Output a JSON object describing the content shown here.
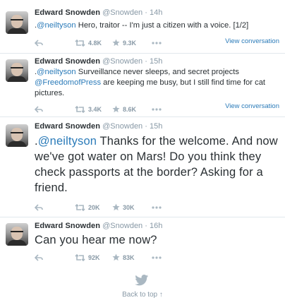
{
  "tweets": [
    {
      "name": "Edward Snowden",
      "handle": "@Snowden",
      "dot": "·",
      "time": "14h",
      "prefix": ".",
      "mention": "@neiltyson",
      "text": " Hero, traitor -- I'm just a citizen with a voice. [1/2]",
      "retweets": "4.8K",
      "favorites": "9.3K",
      "view_conversation": "View conversation"
    },
    {
      "name": "Edward Snowden",
      "handle": "@Snowden",
      "dot": "·",
      "time": "15h",
      "prefix": ".",
      "mention": "@neiltyson",
      "text": " Surveillance never sleeps, and secret projects ",
      "mention2": "@FreedomofPress",
      "text2": " are keeping me busy, but I still find time for cat pictures.",
      "retweets": "3.4K",
      "favorites": "8.6K",
      "view_conversation": "View conversation"
    },
    {
      "name": "Edward Snowden",
      "handle": "@Snowden",
      "dot": "·",
      "time": "15h",
      "prefix": ".",
      "mention": "@neiltyson",
      "text": " Thanks for the welcome. And now we've got water on Mars! Do you think they check passports at the border? Asking for a friend.",
      "retweets": "20K",
      "favorites": "30K"
    },
    {
      "name": "Edward Snowden",
      "handle": "@Snowden",
      "dot": "·",
      "time": "16h",
      "text": "Can you hear me now?",
      "retweets": "92K",
      "favorites": "83K"
    }
  ],
  "footer": {
    "back_to_top": "Back to top ↑"
  },
  "icons": {
    "reply": "reply-icon",
    "retweet": "retweet-icon",
    "favorite": "star-icon",
    "more": "more-icon",
    "bird": "twitter-bird-icon"
  },
  "colors": {
    "link": "#2b7bb9",
    "muted": "#8899a6",
    "icon": "#aab8c2"
  }
}
